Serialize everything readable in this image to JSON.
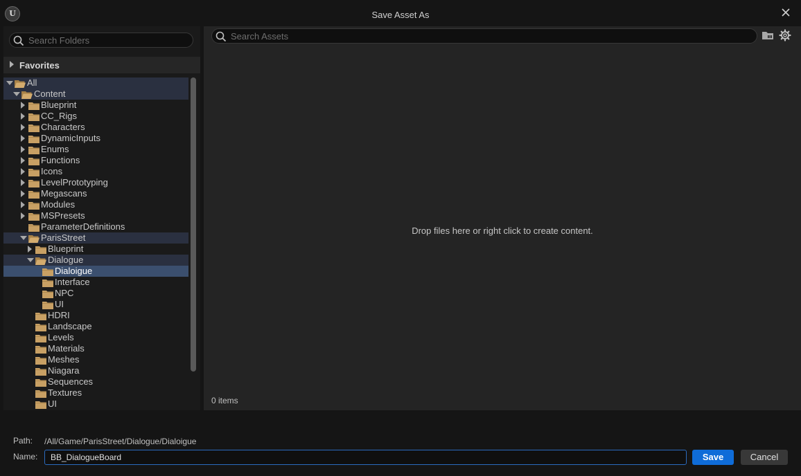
{
  "window": {
    "title": "Save Asset As"
  },
  "folders_panel": {
    "search_placeholder": "Search Folders",
    "favorites_label": "Favorites",
    "tree": [
      {
        "label": "All",
        "depth": 0,
        "expander": "open",
        "folder": "open",
        "state": "hl"
      },
      {
        "label": "Content",
        "depth": 1,
        "expander": "open",
        "folder": "open",
        "state": "hl"
      },
      {
        "label": "Blueprint",
        "depth": 2,
        "expander": "closed",
        "folder": "closed"
      },
      {
        "label": "CC_Rigs",
        "depth": 2,
        "expander": "closed",
        "folder": "closed"
      },
      {
        "label": "Characters",
        "depth": 2,
        "expander": "closed",
        "folder": "closed"
      },
      {
        "label": "DynamicInputs",
        "depth": 2,
        "expander": "closed",
        "folder": "closed"
      },
      {
        "label": "Enums",
        "depth": 2,
        "expander": "closed",
        "folder": "closed"
      },
      {
        "label": "Functions",
        "depth": 2,
        "expander": "closed",
        "folder": "closed"
      },
      {
        "label": "Icons",
        "depth": 2,
        "expander": "closed",
        "folder": "closed"
      },
      {
        "label": "LevelPrototyping",
        "depth": 2,
        "expander": "closed",
        "folder": "closed"
      },
      {
        "label": "Megascans",
        "depth": 2,
        "expander": "closed",
        "folder": "closed"
      },
      {
        "label": "Modules",
        "depth": 2,
        "expander": "closed",
        "folder": "closed"
      },
      {
        "label": "MSPresets",
        "depth": 2,
        "expander": "closed",
        "folder": "closed"
      },
      {
        "label": "ParameterDefinitions",
        "depth": 2,
        "expander": "none",
        "folder": "closed"
      },
      {
        "label": "ParisStreet",
        "depth": 2,
        "expander": "open",
        "folder": "open",
        "state": "hl"
      },
      {
        "label": "Blueprint",
        "depth": 3,
        "expander": "closed",
        "folder": "closed"
      },
      {
        "label": "Dialogue",
        "depth": 3,
        "expander": "open",
        "folder": "open",
        "state": "hl"
      },
      {
        "label": "Dialoigue",
        "depth": 4,
        "expander": "none",
        "folder": "closed",
        "state": "sel"
      },
      {
        "label": "Interface",
        "depth": 4,
        "expander": "none",
        "folder": "closed"
      },
      {
        "label": "NPC",
        "depth": 4,
        "expander": "none",
        "folder": "closed"
      },
      {
        "label": "UI",
        "depth": 4,
        "expander": "none",
        "folder": "closed"
      },
      {
        "label": "HDRI",
        "depth": 3,
        "expander": "none",
        "folder": "closed"
      },
      {
        "label": "Landscape",
        "depth": 3,
        "expander": "none",
        "folder": "closed"
      },
      {
        "label": "Levels",
        "depth": 3,
        "expander": "none",
        "folder": "closed"
      },
      {
        "label": "Materials",
        "depth": 3,
        "expander": "none",
        "folder": "closed"
      },
      {
        "label": "Meshes",
        "depth": 3,
        "expander": "none",
        "folder": "closed"
      },
      {
        "label": "Niagara",
        "depth": 3,
        "expander": "none",
        "folder": "closed"
      },
      {
        "label": "Sequences",
        "depth": 3,
        "expander": "none",
        "folder": "closed"
      },
      {
        "label": "Textures",
        "depth": 3,
        "expander": "none",
        "folder": "closed"
      },
      {
        "label": "UI",
        "depth": 3,
        "expander": "none",
        "folder": "closed"
      }
    ]
  },
  "assets_panel": {
    "search_placeholder": "Search Assets",
    "empty_message": "Drop files here or right click to create content.",
    "item_count": "0 items"
  },
  "footer": {
    "path_label": "Path:",
    "path_value": "/All/Game/ParisStreet/Dialogue/Dialoigue",
    "name_label": "Name:",
    "name_value": "BB_DialogueBoard",
    "save_label": "Save",
    "cancel_label": "Cancel"
  },
  "colors": {
    "accent": "#0f6cd8",
    "folder": "#c8a064",
    "selection": "#3b4f6e",
    "highlight": "#2a3040"
  }
}
